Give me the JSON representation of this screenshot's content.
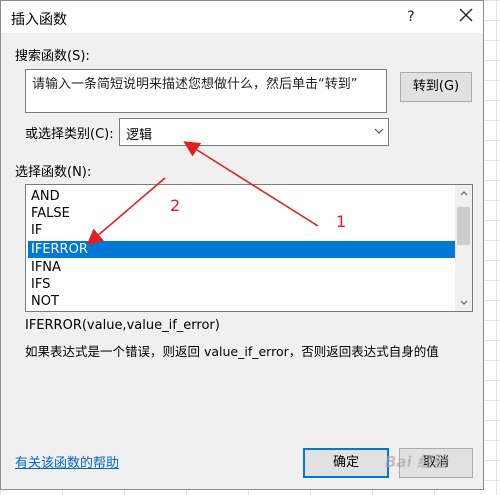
{
  "dialog": {
    "title": "插入函数",
    "help": "?"
  },
  "search": {
    "label": "搜索函数(S):",
    "value": "请输入一条简短说明来描述您想做什么，然后单击“转到”",
    "go_label": "转到(G)"
  },
  "category": {
    "label": "或选择类别(C):",
    "selected": "逻辑"
  },
  "functions": {
    "label": "选择函数(N):",
    "items": [
      "AND",
      "FALSE",
      "IF",
      "IFERROR",
      "IFNA",
      "IFS",
      "NOT"
    ],
    "selected_index": 3
  },
  "detail": {
    "signature": "IFERROR(value,value_if_error)",
    "description": "如果表达式是一个错误，则返回 value_if_error，否则返回表达式自身的值"
  },
  "footer": {
    "help_link": "有关该函数的帮助",
    "ok": "确定",
    "cancel": "取消"
  },
  "annotations": {
    "label_1": "1",
    "label_2": "2",
    "color": "#e02020"
  },
  "watermark": "Bai 经验"
}
